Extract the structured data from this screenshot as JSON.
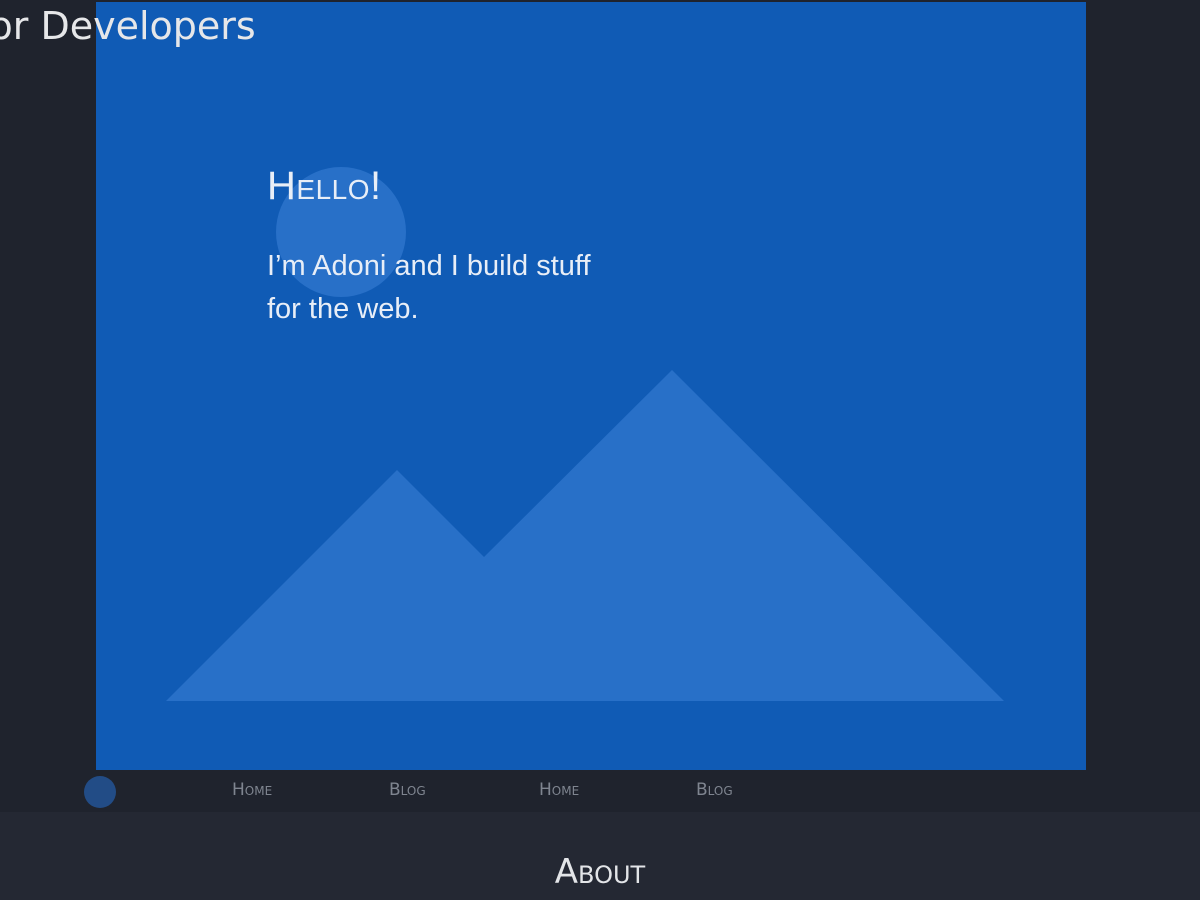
{
  "header": {
    "site_title": "For Developers"
  },
  "hero": {
    "heading": "Hello!",
    "subtitle": "I’m Adoni and I build stuff for the web.",
    "background_color": "#105bb5",
    "shape_color": "#2870c8",
    "art": "mountains-and-sun-illustration"
  },
  "nav": {
    "indicator": "circle-indicator",
    "links": [
      {
        "label": "Home"
      },
      {
        "label": "Blog"
      },
      {
        "label": "Home"
      },
      {
        "label": "Blog"
      }
    ]
  },
  "about": {
    "heading": "About"
  },
  "colors": {
    "page_background": "#1f232d",
    "band_background": "#242833",
    "text_light": "#e6e7e9",
    "text_muted": "#7f8590"
  }
}
